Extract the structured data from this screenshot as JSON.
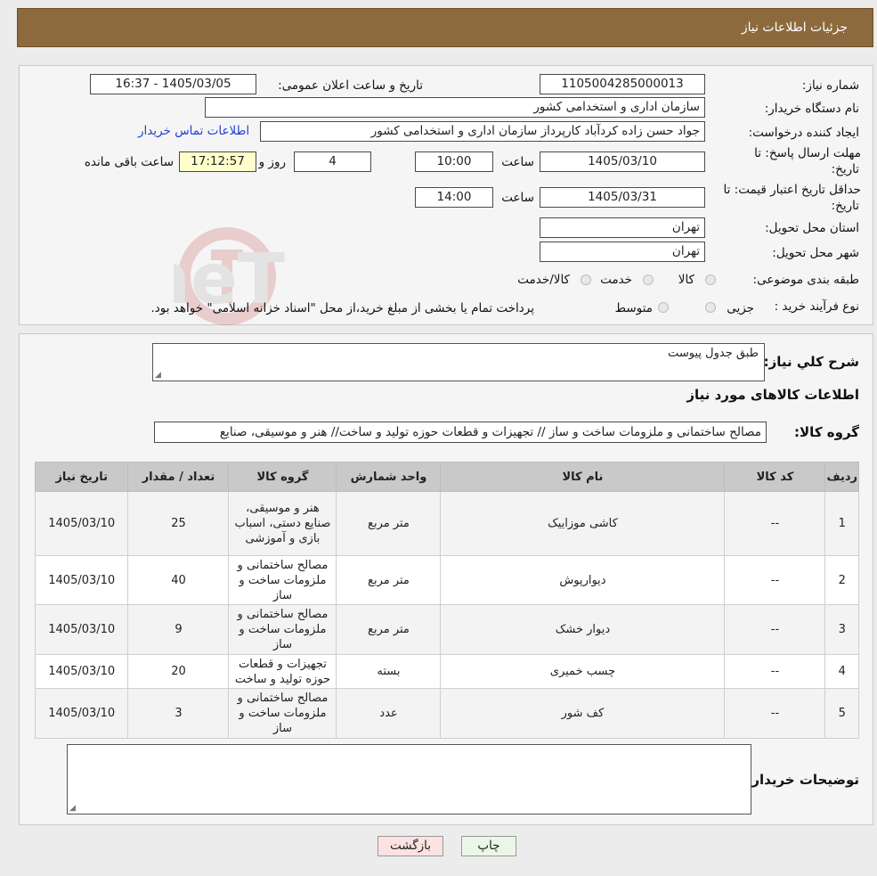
{
  "header": {
    "title": "جزئیات اطلاعات نیاز"
  },
  "form": {
    "need_number_label": "شماره نیاز:",
    "need_number": "1105004285000013",
    "announce_label": "تاریخ و ساعت اعلان عمومی:",
    "announce_value": "1405/03/05 - 16:37",
    "buyer_org_label": "نام دستگاه خریدار:",
    "buyer_org": "سازمان اداری و استخدامی کشور",
    "creator_label": "ایجاد کننده درخواست:",
    "creator": "جواد حسن زاده کردآباد کارپرداز سازمان اداری و استخدامی کشور",
    "contact_link": "اطلاعات تماس خریدار",
    "deadline_label_1": "مهلت ارسال پاسخ: تا",
    "deadline_label_2": "تاریخ:",
    "deadline_date": "1405/03/10",
    "time_label": "ساعت",
    "deadline_time": "10:00",
    "days_value": "4",
    "days_label": "روز و",
    "remaining_time": "17:12:57",
    "remaining_label": "ساعت باقی مانده",
    "validity_label_1": "حداقل تاریخ اعتبار قیمت: تا",
    "validity_label_2": "تاریخ:",
    "validity_date": "1405/03/31",
    "validity_time": "14:00",
    "province_label": "استان محل تحویل:",
    "province": "تهران",
    "city_label": "شهر محل تحویل:",
    "city": "تهران",
    "category_label": "طبقه بندی موضوعی:",
    "category_options": [
      "کالا",
      "خدمت",
      "کالا/خدمت"
    ],
    "process_label": "نوع فرآیند خرید :",
    "process_options": [
      "جزیی",
      "متوسط"
    ],
    "process_note": "پرداخت تمام یا بخشی از مبلغ خرید،از محل \"اسناد خزانه اسلامی\" خواهد بود."
  },
  "details": {
    "summary_label": "شرح کلي نياز:",
    "summary_value": "طبق جدول پیوست",
    "goods_info_title": "اطلاعات کالاهای مورد نیاز",
    "group_label": "گروه کالا:",
    "group_value": "مصالح ساختمانی و ملزومات ساخت و ساز // تجهیزات و قطعات حوزه تولید و ساخت// هنر و موسیقی، صنایع",
    "table_headers": [
      "ردیف",
      "کد کالا",
      "نام کالا",
      "واحد شمارش",
      "گروه کالا",
      "تعداد / مقدار",
      "تاریخ نیاز"
    ],
    "rows": [
      {
        "idx": "1",
        "code": "--",
        "name": "کاشی موزاییک",
        "unit": "متر مربع",
        "group": "هنر و موسیقی، صنایع دستی، اسباب بازی و آموزشی",
        "qty": "25",
        "date": "1405/03/10"
      },
      {
        "idx": "2",
        "code": "--",
        "name": "دیوارپوش",
        "unit": "متر مربع",
        "group": "مصالح ساختمانی و ملزومات ساخت و ساز",
        "qty": "40",
        "date": "1405/03/10"
      },
      {
        "idx": "3",
        "code": "--",
        "name": "دیوار خشک",
        "unit": "متر مربع",
        "group": "مصالح ساختمانی و ملزومات ساخت و ساز",
        "qty": "9",
        "date": "1405/03/10"
      },
      {
        "idx": "4",
        "code": "--",
        "name": "چسب خمیری",
        "unit": "بسته",
        "group": "تجهیزات و قطعات حوزه تولید و ساخت",
        "qty": "20",
        "date": "1405/03/10"
      },
      {
        "idx": "5",
        "code": "--",
        "name": "کف شور",
        "unit": "عدد",
        "group": "مصالح ساختمانی و ملزومات ساخت و ساز",
        "qty": "3",
        "date": "1405/03/10"
      }
    ],
    "buyer_notes_label": "توضیحات خریدار:",
    "buyer_notes_value": ""
  },
  "buttons": {
    "print": "چاپ",
    "back": "بازگشت"
  },
  "watermark": {
    "text": "AriaTender.neT"
  },
  "colors": {
    "header_bg": "#8d6a3e",
    "link": "#1f3fd6",
    "print_bg": "#eaf7e6",
    "back_bg": "#fde2e2",
    "remaining_bg": "#ffffcc"
  }
}
